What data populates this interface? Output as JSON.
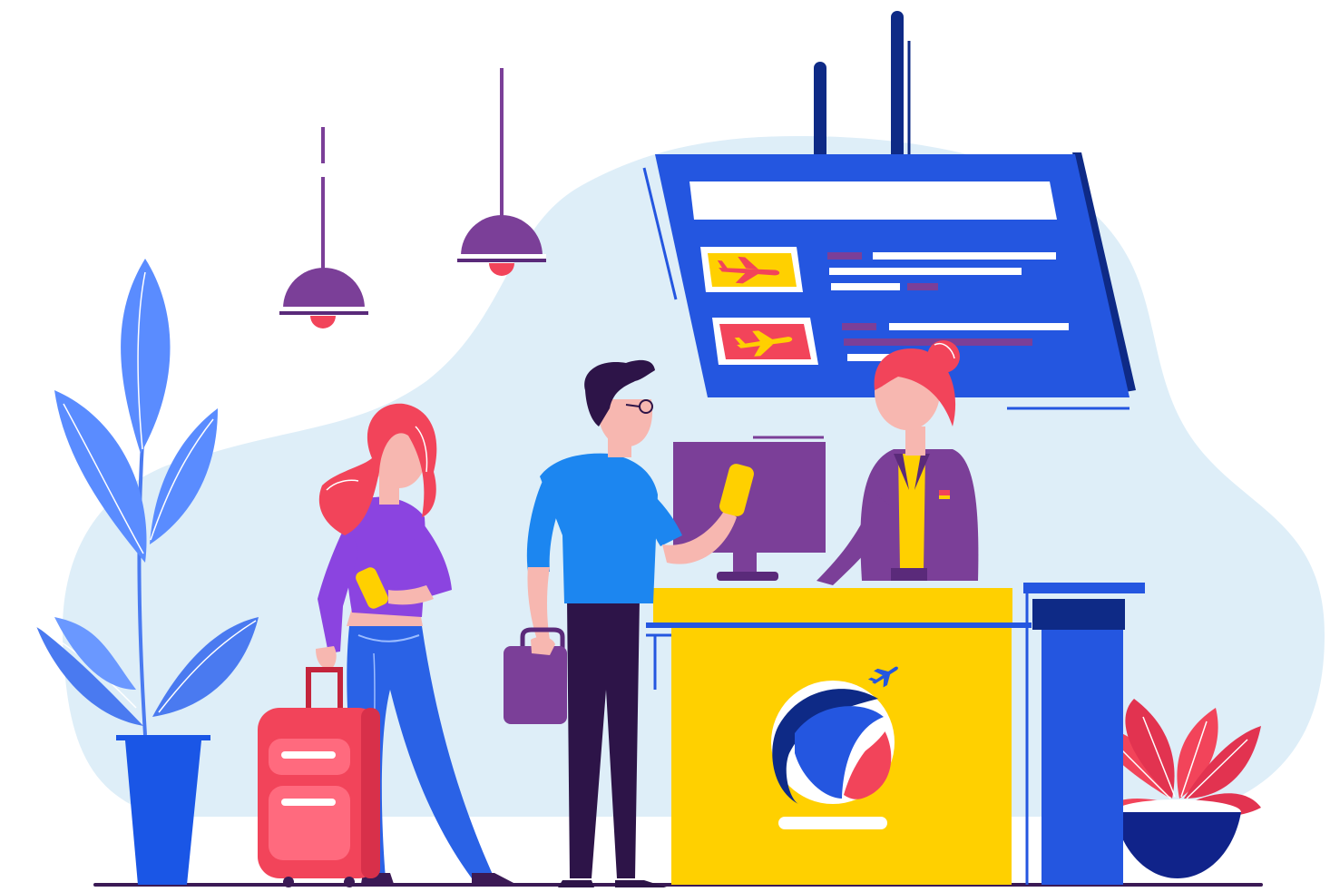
{
  "scene": {
    "description_free": true,
    "palette": {
      "background_blob": "#deeef8",
      "board_blue": "#2456e0",
      "board_dark": "#1a3a9c",
      "navy": "#0e2a86",
      "purple": "#7b3f98",
      "dark_purple": "#4a1c6a",
      "yellow": "#ffd000",
      "red": "#f2445a",
      "pink_skin": "#f7b7b0",
      "plant_blue": "#5a8cff",
      "shirt_blue": "#1c86f0",
      "jeans_blue": "#2a62e6",
      "white": "#ffffff"
    },
    "icons": [
      "airplane-icon",
      "globe-logo",
      "computer-monitor",
      "suitcase-icon",
      "briefcase-icon"
    ]
  }
}
